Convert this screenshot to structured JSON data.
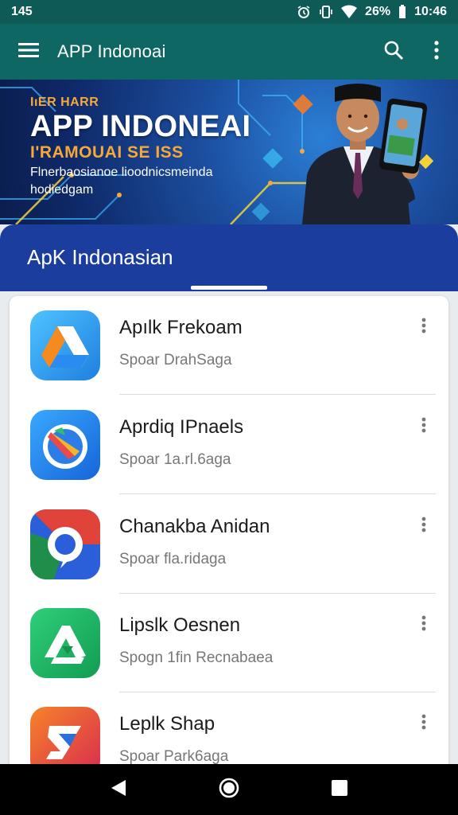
{
  "status_bar": {
    "left_text": "145",
    "battery_text": "26%",
    "time": "10:46",
    "icons": [
      "alarm-icon",
      "vibrate-icon",
      "wifi-icon",
      "battery-icon"
    ]
  },
  "toolbar": {
    "title": "APP Indonoai",
    "icons": [
      "menu-icon",
      "search-icon",
      "more-vert-icon"
    ]
  },
  "banner": {
    "eyebrow": "IıER HARR",
    "headline": "APP INDONEAI",
    "subhead": "I'RAMOUAI SE ISS",
    "desc": "Flnerbaosianoe lioodnicsmeinda hodiedgam"
  },
  "section": {
    "title": "ApK Indonasian"
  },
  "apps": [
    {
      "name": "Apılk Frekoam",
      "sub": "Spoar DrahSaga",
      "icon": "google-drive-like-icon"
    },
    {
      "name": "Aprdiq IPnaels",
      "sub": "Spoar 1a.rl.6aga",
      "icon": "compass-icon"
    },
    {
      "name": "Chanakba Anidan",
      "sub": "Spoar fla.ridaga",
      "icon": "chrome-like-icon"
    },
    {
      "name": "Lipslk Oesnen",
      "sub": "Spogn 1fin Recnabaea",
      "icon": "triangle-arrow-icon"
    },
    {
      "name": "Leplk Shap",
      "sub": "Spoar Park6aga",
      "icon": "shop-s-icon"
    }
  ],
  "nav_bar": {
    "icons": [
      "back-icon",
      "home-icon",
      "recents-icon"
    ]
  },
  "colors": {
    "status_bar": "#0e5a57",
    "toolbar": "#0f6764",
    "section_header": "#1a3d9e",
    "accent_orange": "#f6a83a"
  }
}
